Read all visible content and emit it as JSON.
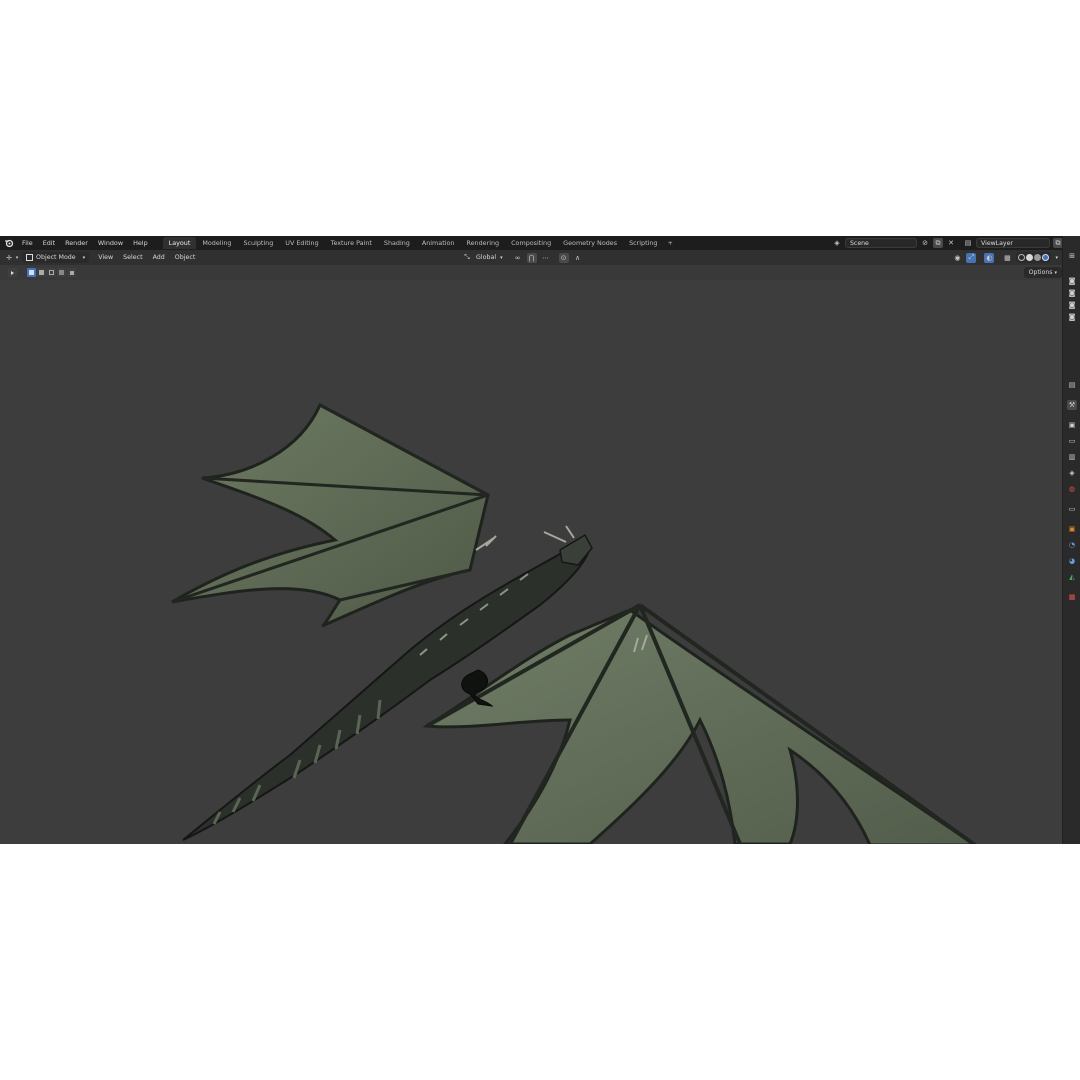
{
  "topbar": {
    "menus": [
      "File",
      "Edit",
      "Render",
      "Window",
      "Help"
    ],
    "workspace_tabs": [
      "Layout",
      "Modeling",
      "Sculpting",
      "UV Editing",
      "Texture Paint",
      "Shading",
      "Animation",
      "Rendering",
      "Compositing",
      "Geometry Nodes",
      "Scripting"
    ],
    "active_tab": "Layout",
    "add_tab_symbol": "+",
    "scene_name": "Scene",
    "view_layer_name": "ViewLayer"
  },
  "header": {
    "mode": "Object Mode",
    "menus": [
      "View",
      "Select",
      "Add",
      "Object"
    ],
    "transform_orientation": "Global"
  },
  "toolrow": {
    "options_label": "Options"
  },
  "icons": {
    "blender_logo": "blender-logo-icon",
    "editor_type": "cursor-arrow-icon",
    "scene_selector": "scene-icon",
    "pin": "pin-icon",
    "view_layer": "view-layer-icon",
    "snap": "magnet-icon",
    "proportional": "proportional-edit-icon",
    "shading_modes": [
      "wireframe-icon",
      "solid-icon",
      "material-preview-icon",
      "rendered-icon"
    ]
  },
  "colors": {
    "accent": "#4772b3",
    "viewport_bg": "#3d3d3d",
    "topbar_bg": "#1d1d1d",
    "header_bg": "#303030",
    "wing_membrane": "#5e6b55",
    "dragon_scales": "#2c302b"
  }
}
